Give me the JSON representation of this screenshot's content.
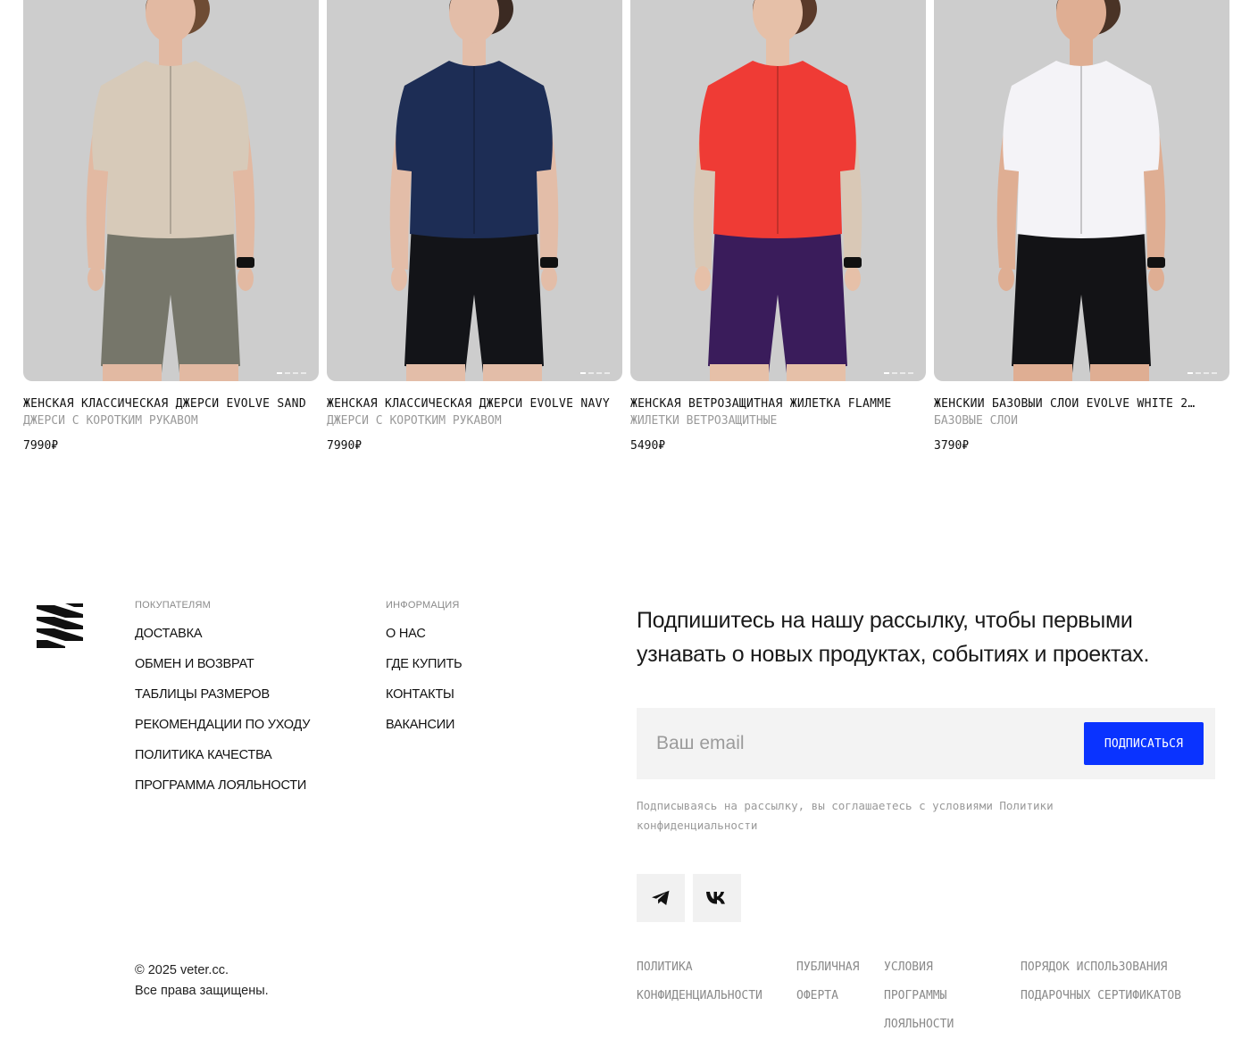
{
  "products": [
    {
      "title": "ЖЕНСКАЯ КЛАССИЧЕСКАЯ ДЖЕРСИ EVOLVE SAND",
      "category": "ДЖЕРСИ С КОРОТКИМ РУКАВОМ",
      "price": "7990₽",
      "image_colors": {
        "top": "#d7cab9",
        "bottom": "#76766a",
        "skin": "#e2b9a2",
        "hair": "#6e4c34"
      },
      "slides": 4,
      "active_slide": 1
    },
    {
      "title": "ЖЕНСКАЯ КЛАССИЧЕСКАЯ ДЖЕРСИ EVOLVE NAVY",
      "category": "ДЖЕРСИ С КОРОТКИМ РУКАВОМ",
      "price": "7990₽",
      "image_colors": {
        "top": "#1d2d55",
        "bottom": "#131418",
        "skin": "#e3bda8",
        "hair": "#3b2a22"
      },
      "slides": 4,
      "active_slide": 1
    },
    {
      "title": "ЖЕНСКАЯ ВЕТРОЗАЩИТНАЯ ЖИЛЕТКА FLAMME",
      "category": "ЖИЛЕТКИ ВЕТРОЗАЩИТНЫЕ",
      "price": "5490₽",
      "image_colors": {
        "top": "#ef3b35",
        "bottom": "#3a1c5b",
        "skin": "#e6c0a8",
        "hair": "#5a3a2a",
        "sleeve": "#d9c8b6"
      },
      "slides": 4,
      "active_slide": 1
    },
    {
      "title": "ЖЕНСКИЙ БАЗОВЫЙ СЛОЙ EVOLVE WHITE 2…",
      "category": "БАЗОВЫЕ СЛОИ",
      "price": "3790₽",
      "image_colors": {
        "top": "#f4f3f7",
        "bottom": "#131316",
        "skin": "#dfae93",
        "hair": "#4a3326"
      },
      "slides": 4,
      "active_slide": 1
    }
  ],
  "footer": {
    "logo_icon": "veter-logo-icon",
    "buyers": {
      "heading": "ПОКУПАТЕЛЯМ",
      "links": [
        "ДОСТАВКА",
        "ОБМЕН И ВОЗВРАТ",
        "ТАБЛИЦЫ РАЗМЕРОВ",
        "РЕКОМЕНДАЦИИ ПО УХОДУ",
        "ПОЛИТИКА КАЧЕСТВА",
        "ПРОГРАММА ЛОЯЛЬНОСТИ"
      ]
    },
    "info": {
      "heading": "ИНФОРМАЦИЯ",
      "links": [
        "О НАС",
        "ГДЕ КУПИТЬ",
        "КОНТАКТЫ",
        "ВАКАНСИИ"
      ]
    },
    "copyright_line1": "© 2025 veter.cc.",
    "copyright_line2": "Все права защищены.",
    "subscribe": {
      "title": "Подпишитесь на нашу рассылку, чтобы первыми узнавать о новых продуктах, событиях и проектах.",
      "email_value": "",
      "email_placeholder": "Ваш email",
      "button_label": "ПОДПИСАТЬСЯ",
      "button_color": "#0a33ff",
      "note": "Подписываясь на рассылку, вы соглашаетесь с условиями Политики конфиденциальности"
    },
    "social": [
      {
        "name": "telegram",
        "icon": "telegram-icon"
      },
      {
        "name": "vk",
        "icon": "vk-icon"
      }
    ],
    "legal": [
      "ПОЛИТИКА КОНФИДЕНЦИАЛЬНОСТИ",
      "ПУБЛИЧНАЯ ОФЕРТА",
      "УСЛОВИЯ ПРОГРАММЫ ЛОЯЛЬНОСТИ",
      "ПОРЯДОК ИСПОЛЬЗОВАНИЯ ПОДАРОЧНЫХ СЕРТИФИКАТОВ"
    ]
  }
}
